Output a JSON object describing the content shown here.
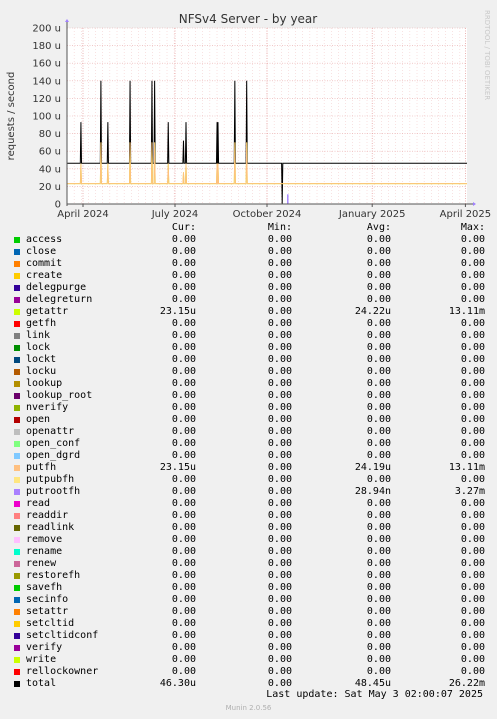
{
  "chart_data": {
    "type": "line",
    "title": "NFSv4 Server - by year",
    "ylabel": "requests / second",
    "watermark": "RRDTOOL / TOBI OETIKER",
    "yticks": [
      "0",
      "20 u",
      "40 u",
      "60 u",
      "80 u",
      "100 u",
      "120 u",
      "140 u",
      "160 u",
      "180 u",
      "200 u"
    ],
    "ylim": [
      0,
      200
    ],
    "xticks": [
      "April 2024",
      "July 2024",
      "October 2024",
      "January 2025",
      "April 2025"
    ],
    "grid": true,
    "series": [
      {
        "name": "total",
        "color": "#000000",
        "baseline": 46.3,
        "spikes": [
          [
            0.04,
            93
          ],
          [
            0.175,
            140
          ],
          [
            0.222,
            93
          ],
          [
            0.372,
            140
          ],
          [
            0.52,
            140
          ],
          [
            0.538,
            140
          ],
          [
            0.63,
            93
          ],
          [
            0.733,
            72
          ],
          [
            0.75,
            93
          ],
          [
            0.96,
            93
          ],
          [
            0.966,
            93
          ],
          [
            1.08,
            140
          ],
          [
            1.16,
            140
          ],
          [
            1.4,
            0
          ]
        ]
      },
      {
        "name": "getattr",
        "color": "#ccff00",
        "baseline": 23.15,
        "spikes": [
          [
            0.04,
            46
          ],
          [
            0.175,
            70
          ],
          [
            0.222,
            46
          ],
          [
            0.372,
            70
          ],
          [
            0.52,
            70
          ],
          [
            0.538,
            70
          ],
          [
            0.63,
            46
          ],
          [
            0.733,
            36
          ],
          [
            0.75,
            46
          ],
          [
            0.96,
            46
          ],
          [
            0.966,
            46
          ],
          [
            1.08,
            70
          ],
          [
            1.16,
            70
          ]
        ]
      },
      {
        "name": "putfh",
        "color": "#ffc080",
        "baseline": 23.15,
        "spikes": [
          [
            0.04,
            46
          ],
          [
            0.175,
            70
          ],
          [
            0.222,
            46
          ],
          [
            0.372,
            70
          ],
          [
            0.52,
            70
          ],
          [
            0.538,
            70
          ],
          [
            0.63,
            46
          ],
          [
            0.733,
            36
          ],
          [
            0.75,
            46
          ],
          [
            0.96,
            46
          ],
          [
            0.966,
            46
          ],
          [
            1.08,
            70
          ],
          [
            1.16,
            70
          ]
        ]
      },
      {
        "name": "putrootfh",
        "color": "#a080ff",
        "spikes": [
          [
            0.73,
            11
          ],
          [
            -0.03,
            30
          ]
        ]
      }
    ]
  },
  "legend": {
    "headers": [
      "Cur:",
      "Min:",
      "Avg:",
      "Max:"
    ],
    "rows": [
      {
        "name": "access",
        "color": "#00cc00",
        "cur": "0.00",
        "min": "0.00",
        "avg": "0.00",
        "max": "0.00"
      },
      {
        "name": "close",
        "color": "#0066b3",
        "cur": "0.00",
        "min": "0.00",
        "avg": "0.00",
        "max": "0.00"
      },
      {
        "name": "commit",
        "color": "#ff8000",
        "cur": "0.00",
        "min": "0.00",
        "avg": "0.00",
        "max": "0.00"
      },
      {
        "name": "create",
        "color": "#ffcc00",
        "cur": "0.00",
        "min": "0.00",
        "avg": "0.00",
        "max": "0.00"
      },
      {
        "name": "delegpurge",
        "color": "#330099",
        "cur": "0.00",
        "min": "0.00",
        "avg": "0.00",
        "max": "0.00"
      },
      {
        "name": "delegreturn",
        "color": "#990099",
        "cur": "0.00",
        "min": "0.00",
        "avg": "0.00",
        "max": "0.00"
      },
      {
        "name": "getattr",
        "color": "#ccff00",
        "cur": "23.15u",
        "min": "0.00",
        "avg": "24.22u",
        "max": "13.11m"
      },
      {
        "name": "getfh",
        "color": "#ff0000",
        "cur": "0.00",
        "min": "0.00",
        "avg": "0.00",
        "max": "0.00"
      },
      {
        "name": "link",
        "color": "#808080",
        "cur": "0.00",
        "min": "0.00",
        "avg": "0.00",
        "max": "0.00"
      },
      {
        "name": "lock",
        "color": "#008f00",
        "cur": "0.00",
        "min": "0.00",
        "avg": "0.00",
        "max": "0.00"
      },
      {
        "name": "lockt",
        "color": "#00487d",
        "cur": "0.00",
        "min": "0.00",
        "avg": "0.00",
        "max": "0.00"
      },
      {
        "name": "locku",
        "color": "#b35a00",
        "cur": "0.00",
        "min": "0.00",
        "avg": "0.00",
        "max": "0.00"
      },
      {
        "name": "lookup",
        "color": "#b38f00",
        "cur": "0.00",
        "min": "0.00",
        "avg": "0.00",
        "max": "0.00"
      },
      {
        "name": "lookup_root",
        "color": "#6b006b",
        "cur": "0.00",
        "min": "0.00",
        "avg": "0.00",
        "max": "0.00"
      },
      {
        "name": "nverify",
        "color": "#8fb300",
        "cur": "0.00",
        "min": "0.00",
        "avg": "0.00",
        "max": "0.00"
      },
      {
        "name": "open",
        "color": "#b30000",
        "cur": "0.00",
        "min": "0.00",
        "avg": "0.00",
        "max": "0.00"
      },
      {
        "name": "openattr",
        "color": "#bebebe",
        "cur": "0.00",
        "min": "0.00",
        "avg": "0.00",
        "max": "0.00"
      },
      {
        "name": "open_conf",
        "color": "#80ff80",
        "cur": "0.00",
        "min": "0.00",
        "avg": "0.00",
        "max": "0.00"
      },
      {
        "name": "open_dgrd",
        "color": "#80c9ff",
        "cur": "0.00",
        "min": "0.00",
        "avg": "0.00",
        "max": "0.00"
      },
      {
        "name": "putfh",
        "color": "#ffc080",
        "cur": "23.15u",
        "min": "0.00",
        "avg": "24.19u",
        "max": "13.11m"
      },
      {
        "name": "putpubfh",
        "color": "#ffe680",
        "cur": "0.00",
        "min": "0.00",
        "avg": "0.00",
        "max": "0.00"
      },
      {
        "name": "putrootfh",
        "color": "#aa80ff",
        "cur": "0.00",
        "min": "0.00",
        "avg": "28.94n",
        "max": "3.27m"
      },
      {
        "name": "read",
        "color": "#ee00cc",
        "cur": "0.00",
        "min": "0.00",
        "avg": "0.00",
        "max": "0.00"
      },
      {
        "name": "readdir",
        "color": "#ff8080",
        "cur": "0.00",
        "min": "0.00",
        "avg": "0.00",
        "max": "0.00"
      },
      {
        "name": "readlink",
        "color": "#666600",
        "cur": "0.00",
        "min": "0.00",
        "avg": "0.00",
        "max": "0.00"
      },
      {
        "name": "remove",
        "color": "#ffbfff",
        "cur": "0.00",
        "min": "0.00",
        "avg": "0.00",
        "max": "0.00"
      },
      {
        "name": "rename",
        "color": "#00ffcc",
        "cur": "0.00",
        "min": "0.00",
        "avg": "0.00",
        "max": "0.00"
      },
      {
        "name": "renew",
        "color": "#cc6699",
        "cur": "0.00",
        "min": "0.00",
        "avg": "0.00",
        "max": "0.00"
      },
      {
        "name": "restorefh",
        "color": "#999900",
        "cur": "0.00",
        "min": "0.00",
        "avg": "0.00",
        "max": "0.00"
      },
      {
        "name": "savefh",
        "color": "#00cc00",
        "cur": "0.00",
        "min": "0.00",
        "avg": "0.00",
        "max": "0.00"
      },
      {
        "name": "secinfo",
        "color": "#0066b3",
        "cur": "0.00",
        "min": "0.00",
        "avg": "0.00",
        "max": "0.00"
      },
      {
        "name": "setattr",
        "color": "#ff8000",
        "cur": "0.00",
        "min": "0.00",
        "avg": "0.00",
        "max": "0.00"
      },
      {
        "name": "setcltid",
        "color": "#ffcc00",
        "cur": "0.00",
        "min": "0.00",
        "avg": "0.00",
        "max": "0.00"
      },
      {
        "name": "setcltidconf",
        "color": "#330099",
        "cur": "0.00",
        "min": "0.00",
        "avg": "0.00",
        "max": "0.00"
      },
      {
        "name": "verify",
        "color": "#990099",
        "cur": "0.00",
        "min": "0.00",
        "avg": "0.00",
        "max": "0.00"
      },
      {
        "name": "write",
        "color": "#ccff00",
        "cur": "0.00",
        "min": "0.00",
        "avg": "0.00",
        "max": "0.00"
      },
      {
        "name": "rellockowner",
        "color": "#ff0000",
        "cur": "0.00",
        "min": "0.00",
        "avg": "0.00",
        "max": "0.00"
      },
      {
        "name": "total",
        "color": "#000000",
        "cur": "46.30u",
        "min": "0.00",
        "avg": "48.45u",
        "max": "26.22m"
      }
    ]
  },
  "footer": {
    "last_update": "Last update: Sat May  3 02:00:07 2025",
    "generator": "Munin 2.0.56"
  }
}
